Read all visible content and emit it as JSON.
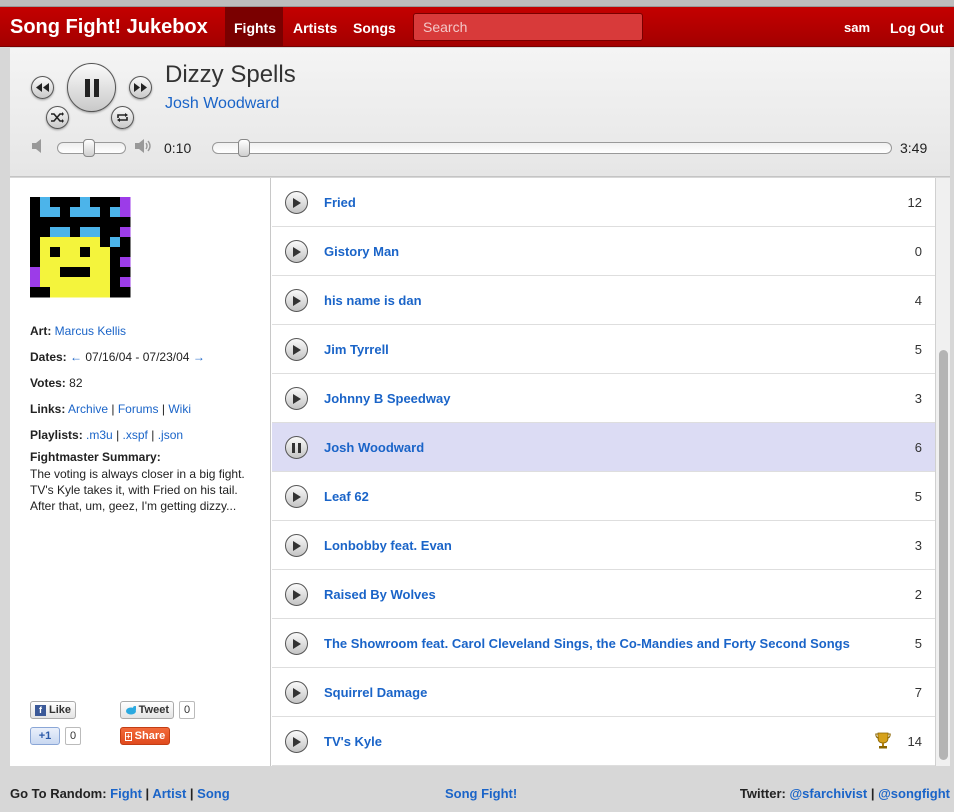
{
  "nav": {
    "brand": "Song Fight! Jukebox",
    "links": [
      "Fights",
      "Artists",
      "Songs"
    ],
    "search_placeholder": "Search",
    "user": "sam",
    "logout": "Log Out"
  },
  "player": {
    "title": "Dizzy Spells",
    "artist": "Josh Woodward",
    "current_time": "0:10",
    "duration": "3:49",
    "volume_level": 0.45,
    "progress_fraction": 0.044
  },
  "fight": {
    "art_label": "Art:",
    "art_artist": "Marcus Kellis",
    "dates_label": "Dates:",
    "prev_arrow": "←",
    "dates": "07/16/04 - 07/23/04",
    "next_arrow": "→",
    "votes_label": "Votes:",
    "votes": "82",
    "links_label": "Links:",
    "links": [
      "Archive",
      "Forums",
      "Wiki"
    ],
    "playlists_label": "Playlists:",
    "playlists": [
      ".m3u",
      ".xspf",
      ".json"
    ],
    "separator": "|",
    "summary_label": "Fightmaster Summary:",
    "summary": "The voting is always closer in a big fight. TV's Kyle takes it, with Fried on his tail. After that, um, geez, I'm getting dizzy..."
  },
  "social": {
    "like": "Like",
    "tweet": "Tweet",
    "tweet_count": "0",
    "plusone": "+1",
    "plusone_count": "0",
    "share": "Share"
  },
  "songs": [
    {
      "name": "Fried",
      "votes": "12"
    },
    {
      "name": "Gistory Man",
      "votes": "0"
    },
    {
      "name": "his name is dan",
      "votes": "4"
    },
    {
      "name": "Jim Tyrrell",
      "votes": "5"
    },
    {
      "name": "Johnny B Speedway",
      "votes": "3"
    },
    {
      "name": "Josh Woodward",
      "votes": "6"
    },
    {
      "name": "Leaf 62",
      "votes": "5"
    },
    {
      "name": "Lonbobby feat. Evan",
      "votes": "3"
    },
    {
      "name": "Raised By Wolves",
      "votes": "2"
    },
    {
      "name": "The Showroom feat. Carol Cleveland Sings, the Co-Mandies and Forty Second Songs",
      "votes": "5"
    },
    {
      "name": "Squirrel Damage",
      "votes": "7"
    },
    {
      "name": "TV's Kyle",
      "votes": "14"
    }
  ],
  "footer": {
    "random_label": "Go To Random:",
    "random_links": [
      "Fight",
      "Artist",
      "Song"
    ],
    "center": "Song Fight!",
    "twitter_label": "Twitter:",
    "twitter_links": [
      "@sfarchivist",
      "@songfight"
    ],
    "separator": "|"
  },
  "colors": {
    "brand_red": "#b80000",
    "link_blue": "#1a64c8",
    "playing_row": "#dcdcf4"
  }
}
